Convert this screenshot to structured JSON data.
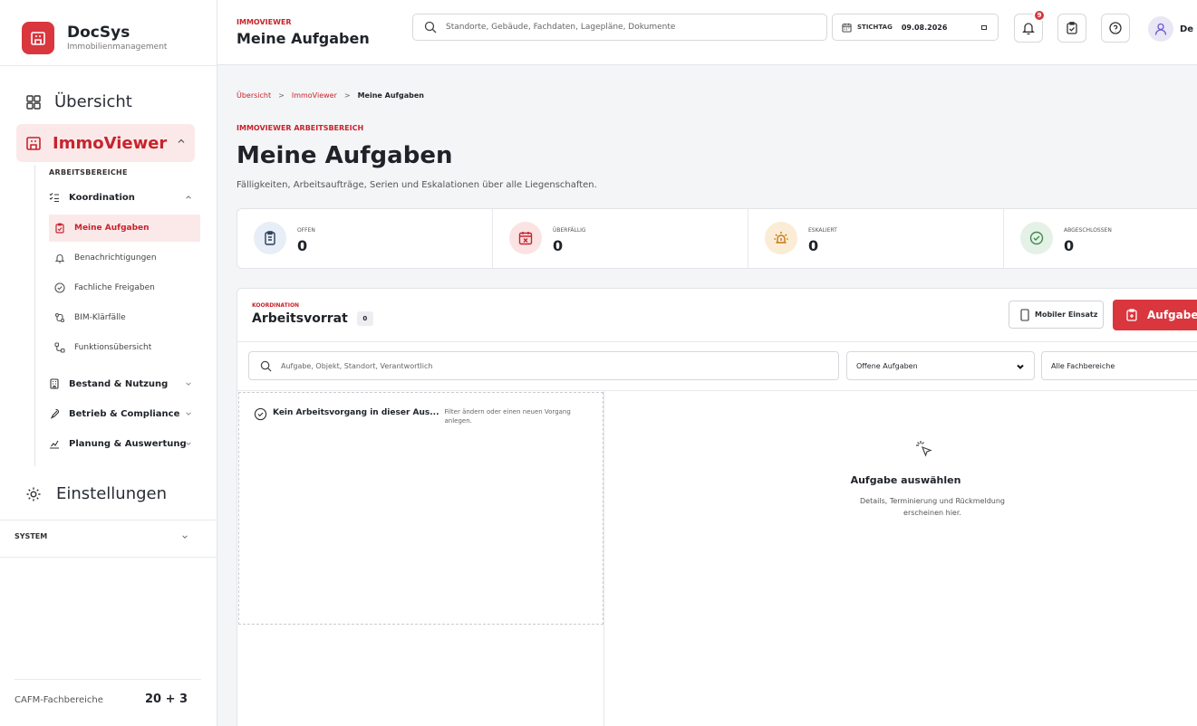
{
  "brand": {
    "name": "DocSys",
    "subtitle": "Immobilienmanagement"
  },
  "sidebar": {
    "overview": "Übersicht",
    "group": "ImmoViewer",
    "section_label": "ARBEITSBEREICHE",
    "koordination": "Koordination",
    "leaves": [
      "Meine Aufgaben",
      "Benachrichtigungen",
      "Fachliche Freigaben",
      "BIM-Klärfälle",
      "Funktionsübersicht"
    ],
    "groups": [
      "Bestand & Nutzung",
      "Betrieb & Compliance",
      "Planung & Auswertung"
    ],
    "settings": "Einstellungen",
    "system": "SYSTEM",
    "footer_label": "CAFM-Fachbereiche",
    "footer_value": "20 + 3"
  },
  "topbar": {
    "kicker": "IMMOVIEWER",
    "title": "Meine Aufgaben",
    "search_placeholder": "Standorte, Gebäude, Fachdaten, Lagepläne, Dokumente",
    "date_label": "STICHTAG",
    "date_value": "09.08.2026",
    "notification_count": "9",
    "user_name": "De"
  },
  "breadcrumb": {
    "items": [
      "Übersicht",
      "ImmoViewer",
      "Meine Aufgaben"
    ],
    "separator": ">"
  },
  "page": {
    "kicker": "IMMOVIEWER ARBEITSBEREICH",
    "title": "Meine Aufgaben",
    "subtitle": "Fälligkeiten, Arbeitsaufträge, Serien und Eskalationen über alle Liegenschaften."
  },
  "stats": [
    {
      "label": "OFFEN",
      "value": "0",
      "color": "#2f6fb0",
      "bg": "#e7eef7"
    },
    {
      "label": "ÜBERFÄLLIG",
      "value": "0",
      "color": "#c8232c",
      "bg": "#fbe3e4"
    },
    {
      "label": "ESKALIERT",
      "value": "0",
      "color": "#c47a12",
      "bg": "#fbecd6"
    },
    {
      "label": "ABGESCHLOSSEN",
      "value": "0",
      "color": "#3f8a4f",
      "bg": "#e5f1e7"
    }
  ],
  "panel": {
    "kicker": "KOORDINATION",
    "title": "Arbeitsvorrat",
    "count": "0",
    "mobile_button": "Mobiler Einsatz",
    "add_button": "Aufgabe anlegen",
    "search_placeholder": "Aufgabe, Objekt, Standort, Verantwortlich",
    "filter_status": "Offene Aufgaben",
    "filter_area": "Alle Fachbereiche",
    "empty_title": "Kein Arbeitsvorgang in dieser Aus...",
    "empty_desc": "Filter ändern oder einen neuen Vorgang anlegen.",
    "detail_title": "Aufgabe auswählen",
    "detail_desc": "Details, Terminierung und Rückmeldung erscheinen hier."
  },
  "colors": {
    "accent": "#d9363e",
    "accent_soft": "#fbe9ea"
  }
}
